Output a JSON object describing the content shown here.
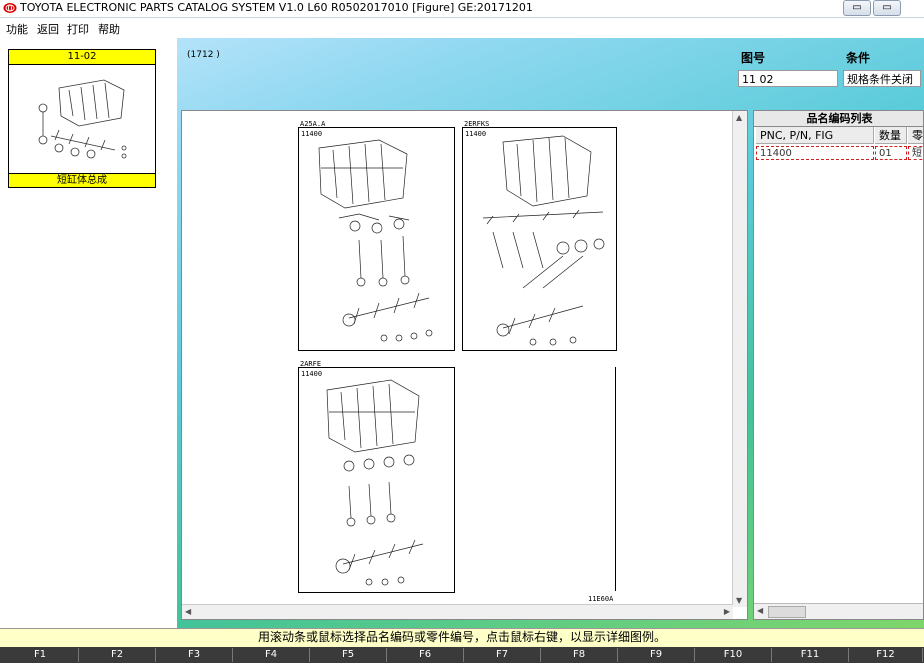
{
  "window": {
    "title": "TOYOTA ELECTRONIC PARTS CATALOG SYSTEM V1.0 L60 R0502017010 [Figure] GE:20171201",
    "minimize_label": "▭",
    "restore_label": "▭"
  },
  "menu": [
    "功能",
    "返回",
    "打印",
    "帮助"
  ],
  "thumbnail": {
    "code": "11-02",
    "caption": "短缸体总成"
  },
  "figure_code": "(1712        )",
  "form": {
    "figure_number_label": "图号",
    "figure_number_value": "11 02",
    "condition_label": "条件",
    "condition_value": "规格条件关闭"
  },
  "diagrams": [
    {
      "engine": "A25A.A",
      "pnc": "11400"
    },
    {
      "engine": "2ERFKS",
      "pnc": "11400"
    },
    {
      "engine": "2ARFE",
      "pnc": "11400"
    }
  ],
  "diagram_ref": "11E60A",
  "parts_list": {
    "title": "品名编码列表",
    "columns": [
      "PNC, P/N, FIG",
      "数量",
      "零"
    ],
    "rows": [
      {
        "pnc": "11400",
        "qty": "01",
        "name": "短"
      }
    ]
  },
  "status_text": "用滚动条或鼠标选择品名编码或零件编号，点击鼠标右键，以显示详细图例。",
  "function_keys": [
    "F1",
    "F2",
    "F3",
    "F4",
    "F5",
    "F6",
    "F7",
    "F8",
    "F9",
    "F10",
    "F11",
    "F12"
  ]
}
